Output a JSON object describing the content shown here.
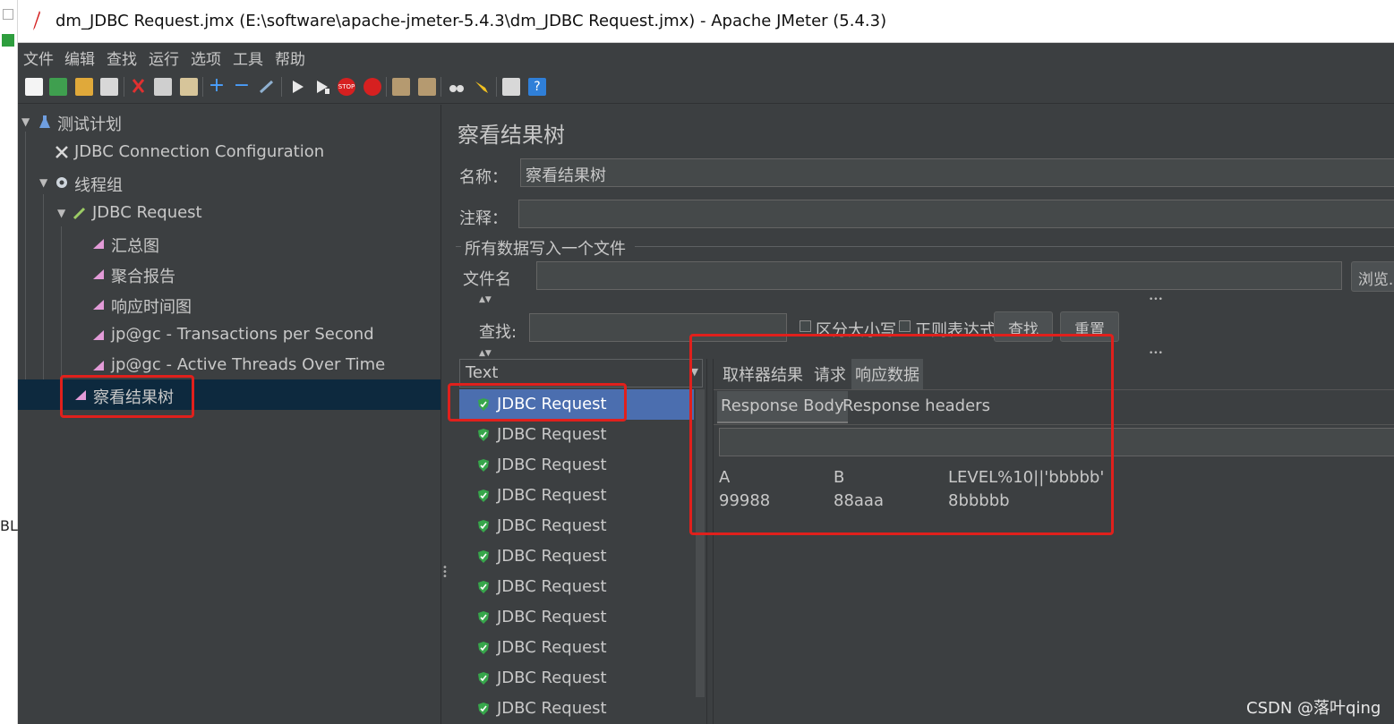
{
  "window": {
    "title": "dm_JDBC Request.jmx (E:\\software\\apache-jmeter-5.4.3\\dm_JDBC Request.jmx) - Apache JMeter (5.4.3)"
  },
  "background_window": {
    "edge_text": "BL"
  },
  "menu": [
    "文件",
    "编辑",
    "查找",
    "运行",
    "选项",
    "工具",
    "帮助"
  ],
  "toolbar_icons": [
    "new-icon",
    "templates-icon",
    "open-icon",
    "save-icon",
    "cut-icon",
    "copy-icon",
    "paste-icon",
    "expand-icon",
    "collapse-icon",
    "toggle-icon",
    "start-icon",
    "start-no-pause-icon",
    "stop-icon",
    "shutdown-icon",
    "clear-icon",
    "clear-all-icon",
    "search-icon",
    "reset-search-icon",
    "function-helper-icon",
    "help-icon"
  ],
  "tree": {
    "items": [
      {
        "label": "测试计划",
        "icon": "test-plan-icon",
        "level": 0,
        "expanded": true
      },
      {
        "label": "JDBC Connection Configuration",
        "icon": "config-icon",
        "level": 1
      },
      {
        "label": "线程组",
        "icon": "thread-group-icon",
        "level": 1,
        "expanded": true
      },
      {
        "label": "JDBC Request",
        "icon": "sampler-icon",
        "level": 2,
        "expanded": true
      },
      {
        "label": "汇总图",
        "icon": "listener-icon",
        "level": 3
      },
      {
        "label": "聚合报告",
        "icon": "listener-icon",
        "level": 3
      },
      {
        "label": "响应时间图",
        "icon": "listener-icon",
        "level": 3
      },
      {
        "label": "jp@gc - Transactions per Second",
        "icon": "listener-icon",
        "level": 3
      },
      {
        "label": "jp@gc - Active Threads Over Time",
        "icon": "listener-icon",
        "level": 3
      },
      {
        "label": "察看结果树",
        "icon": "listener-icon",
        "level": 3,
        "selected": true
      }
    ]
  },
  "panel": {
    "title": "察看结果树",
    "name_label": "名称：",
    "name_value": "察看结果树",
    "comment_label": "注释：",
    "comment_value": "",
    "file_group_label": "所有数据写入一个文件",
    "filename_label": "文件名",
    "filename_value": "",
    "browse_button": "浏览...",
    "search_label": "查找:",
    "search_value": "",
    "case_sensitive_label": "区分大小写",
    "regex_label": "正则表达式",
    "search_button": "查找",
    "reset_button": "重置",
    "renderer_selected": "Text"
  },
  "results": {
    "items": [
      "JDBC Request",
      "JDBC Request",
      "JDBC Request",
      "JDBC Request",
      "JDBC Request",
      "JDBC Request",
      "JDBC Request",
      "JDBC Request",
      "JDBC Request",
      "JDBC Request",
      "JDBC Request"
    ],
    "selected_index": 0
  },
  "detail": {
    "tabs": [
      "取样器结果",
      "请求",
      "响应数据"
    ],
    "active_tab": 2,
    "subtabs": [
      "Response Body",
      "Response headers"
    ],
    "active_subtab": 0,
    "table": {
      "headers": [
        "A",
        "B",
        "LEVEL%10||'bbbbb'"
      ],
      "rows": [
        [
          "99988",
          "88aaa",
          "8bbbbb"
        ]
      ]
    }
  },
  "watermark": "CSDN @落叶qing",
  "colors": {
    "background": "#3c3f41",
    "text": "#c8c8c8",
    "selection_tree": "#0d293e",
    "selection_list": "#4b6eaf",
    "highlight_box": "#e0201c",
    "success_shield": "#37a64b"
  }
}
